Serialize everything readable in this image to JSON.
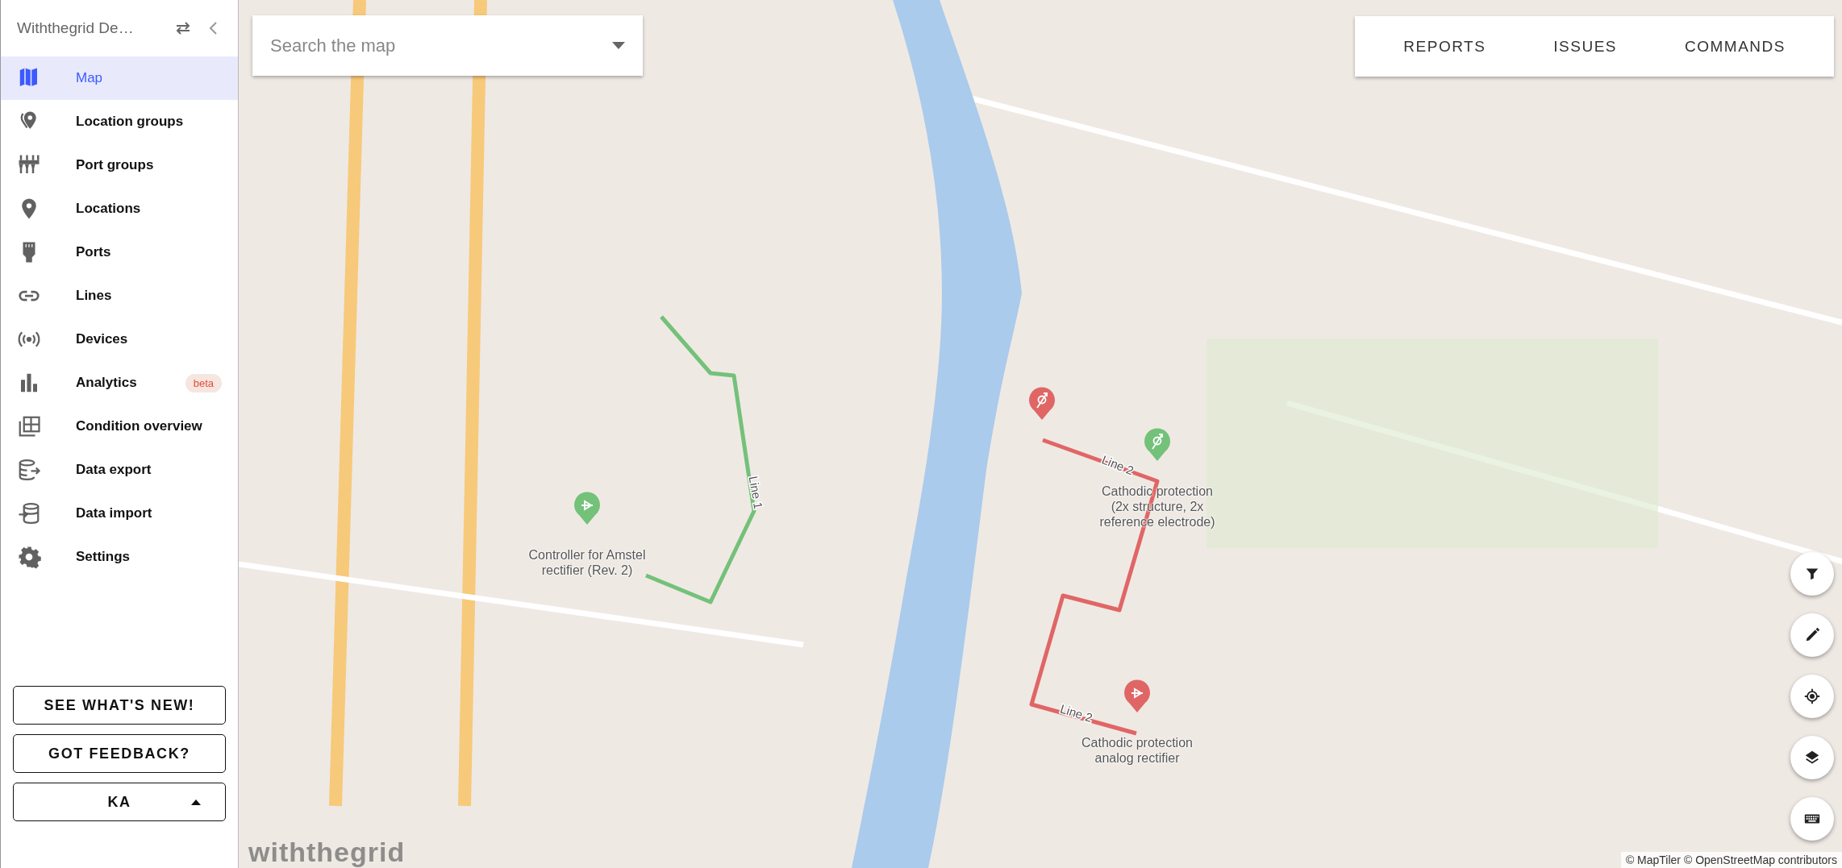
{
  "sidebar": {
    "title": "Withthegrid De…",
    "items": [
      {
        "label": "Map",
        "selected": true
      },
      {
        "label": "Location groups",
        "selected": false
      },
      {
        "label": "Port groups",
        "selected": false
      },
      {
        "label": "Locations",
        "selected": false
      },
      {
        "label": "Ports",
        "selected": false
      },
      {
        "label": "Lines",
        "selected": false
      },
      {
        "label": "Devices",
        "selected": false
      },
      {
        "label": "Analytics",
        "selected": false,
        "badge": "beta"
      },
      {
        "label": "Condition overview",
        "selected": false
      },
      {
        "label": "Data export",
        "selected": false
      },
      {
        "label": "Data import",
        "selected": false
      },
      {
        "label": "Settings",
        "selected": false
      }
    ],
    "buttons": [
      "SEE WHAT'S NEW!",
      "GOT FEEDBACK?"
    ],
    "user_menu": "KA"
  },
  "map": {
    "search": {
      "placeholder": "Search the map"
    },
    "top_menu": [
      "REPORTS",
      "ISSUES",
      "COMMANDS"
    ],
    "lines": [
      {
        "labels": [
          "Line 1"
        ],
        "color": "#74c17a"
      },
      {
        "labels": [
          "Line 2",
          "Line 2"
        ],
        "color": "#e06666"
      }
    ],
    "markers": [
      {
        "kind": "rectifier",
        "color": "#74c17a",
        "label": "Controller for Amstel rectifier (Rev. 2)"
      },
      {
        "kind": "probe",
        "color": "#e06666"
      },
      {
        "kind": "probe",
        "color": "#74c17a",
        "label": "Cathodic protection (2x structure, 2x reference electrode)"
      },
      {
        "kind": "rectifier",
        "color": "#e06666",
        "label": "Cathodic protection analog rectifier"
      }
    ],
    "logo": "withthegrid",
    "attribution": "© MapTiler © OpenStreetMap contributors"
  }
}
